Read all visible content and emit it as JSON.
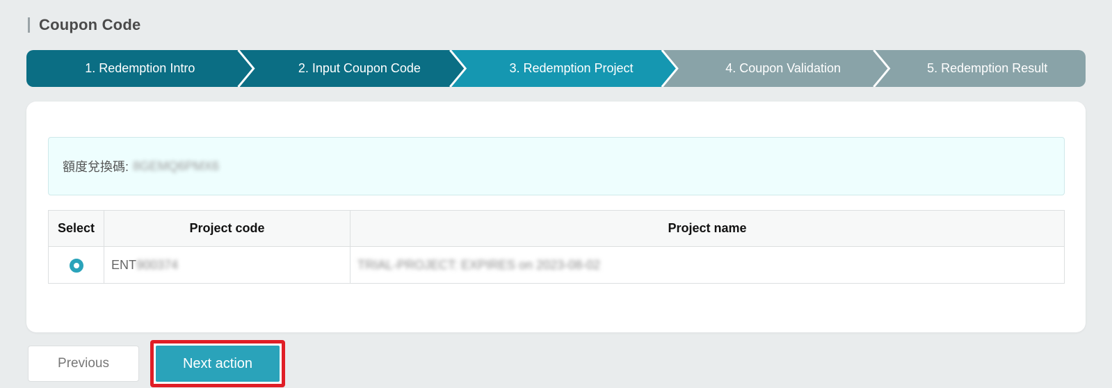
{
  "page": {
    "title": "Coupon Code"
  },
  "stepper": {
    "steps": [
      {
        "label": "1. Redemption Intro",
        "state": "done"
      },
      {
        "label": "2. Input Coupon Code",
        "state": "done"
      },
      {
        "label": "3. Redemption Project",
        "state": "active"
      },
      {
        "label": "4. Coupon Validation",
        "state": "pending"
      },
      {
        "label": "5. Redemption Result",
        "state": "pending"
      }
    ],
    "colors": {
      "done": "#0b6e84",
      "active": "#1597b1",
      "pending": "#89a3a8"
    }
  },
  "coupon": {
    "label": "額度兌換碼:",
    "value": "8GEMQ6PMX6"
  },
  "table": {
    "headers": {
      "select": "Select",
      "code": "Project code",
      "name": "Project name"
    },
    "rows": [
      {
        "selected": true,
        "code_prefix": "ENT",
        "code_rest": "900374",
        "name": "TRIAL-PROJECT: EXPIRES on 2023-08-02"
      }
    ]
  },
  "actions": {
    "previous_label": "Previous",
    "next_label": "Next action"
  },
  "colors": {
    "accent": "#2aa3ba",
    "highlight": "#e01e26"
  }
}
